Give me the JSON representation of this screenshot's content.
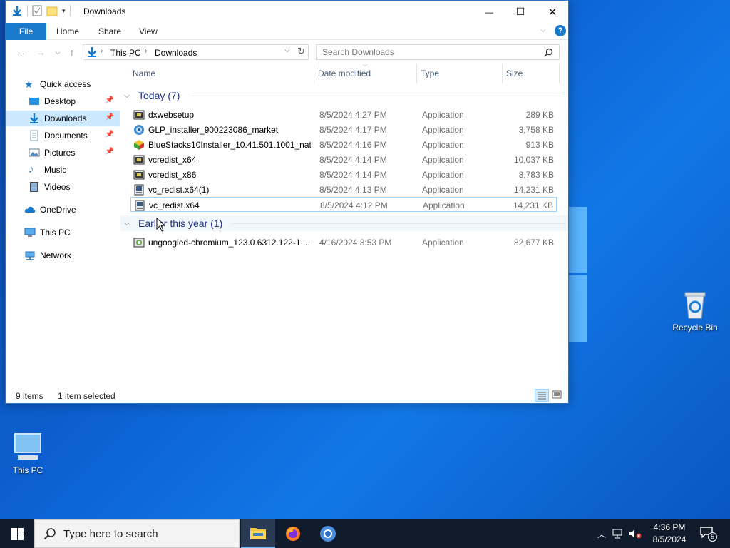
{
  "window": {
    "title": "Downloads",
    "minimize_glyph": "—",
    "maximize_glyph": "☐",
    "close_glyph": "✕"
  },
  "ribbon": {
    "file": "File",
    "home": "Home",
    "share": "Share",
    "view": "View"
  },
  "address": {
    "crumb1": "This PC",
    "crumb2": "Downloads",
    "search_placeholder": "Search Downloads"
  },
  "nav": {
    "quick_access": "Quick access",
    "desktop": "Desktop",
    "downloads": "Downloads",
    "documents": "Documents",
    "pictures": "Pictures",
    "music": "Music",
    "videos": "Videos",
    "onedrive": "OneDrive",
    "this_pc": "This PC",
    "network": "Network"
  },
  "columns": {
    "name": "Name",
    "date": "Date modified",
    "type": "Type",
    "size": "Size"
  },
  "groups": {
    "today": "Today (7)",
    "earlier": "Earlier this year (1)"
  },
  "files": [
    {
      "name": "dxwebsetup",
      "date": "8/5/2024 4:27 PM",
      "type": "Application",
      "size": "289 KB"
    },
    {
      "name": "GLP_installer_900223086_market",
      "date": "8/5/2024 4:17 PM",
      "type": "Application",
      "size": "3,758 KB"
    },
    {
      "name": "BlueStacks10Installer_10.41.501.1001_nati...",
      "date": "8/5/2024 4:16 PM",
      "type": "Application",
      "size": "913 KB"
    },
    {
      "name": "vcredist_x64",
      "date": "8/5/2024 4:14 PM",
      "type": "Application",
      "size": "10,037 KB"
    },
    {
      "name": "vcredist_x86",
      "date": "8/5/2024 4:14 PM",
      "type": "Application",
      "size": "8,783 KB"
    },
    {
      "name": "vc_redist.x64(1)",
      "date": "8/5/2024 4:13 PM",
      "type": "Application",
      "size": "14,231 KB"
    },
    {
      "name": "vc_redist.x64",
      "date": "8/5/2024 4:12 PM",
      "type": "Application",
      "size": "14,231 KB"
    },
    {
      "name": "ungoogled-chromium_123.0.6312.122-1....",
      "date": "4/16/2024 3:53 PM",
      "type": "Application",
      "size": "82,677 KB"
    }
  ],
  "status": {
    "items": "9 items",
    "selected": "1 item selected"
  },
  "desktop_icons": {
    "recycle_bin": "Recycle Bin",
    "this_pc": "This PC"
  },
  "taskbar": {
    "search_text": "Type here to search",
    "time": "4:36 PM",
    "date": "8/5/2024",
    "notification_count": "5"
  },
  "colors": {
    "accent": "#1979ca",
    "selection": "#cce8ff",
    "group_text": "#1e3287"
  }
}
